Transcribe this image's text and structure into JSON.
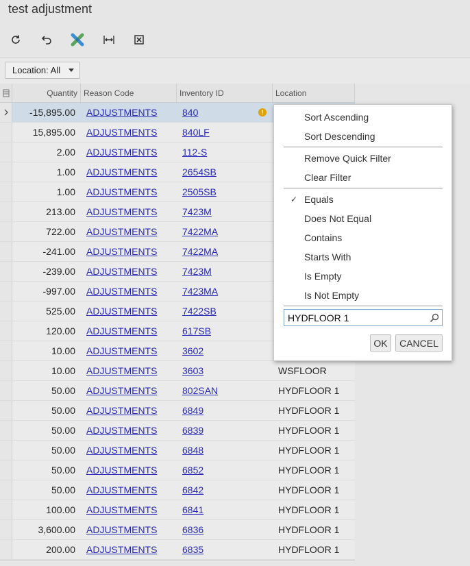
{
  "page": {
    "title": "test adjustment"
  },
  "toolbar": {
    "icons": [
      "refresh-icon",
      "undo-icon",
      "fit-columns-icon",
      "fit-width-icon",
      "export-excel-icon"
    ]
  },
  "filter": {
    "location_label": "Location: All"
  },
  "grid": {
    "columns": {
      "quantity": "Quantity",
      "reason": "Reason Code",
      "inventory": "Inventory ID",
      "location": "Location"
    },
    "rows": [
      {
        "qty": "-15,895.00",
        "reason": "ADJUSTMENTS",
        "inv": "840",
        "loc": ""
      },
      {
        "qty": "15,895.00",
        "reason": "ADJUSTMENTS",
        "inv": "840LF",
        "loc": ""
      },
      {
        "qty": "2.00",
        "reason": "ADJUSTMENTS",
        "inv": "112-S",
        "loc": ""
      },
      {
        "qty": "1.00",
        "reason": "ADJUSTMENTS",
        "inv": "2654SB",
        "loc": ""
      },
      {
        "qty": "1.00",
        "reason": "ADJUSTMENTS",
        "inv": "2505SB",
        "loc": ""
      },
      {
        "qty": "213.00",
        "reason": "ADJUSTMENTS",
        "inv": "7423M",
        "loc": ""
      },
      {
        "qty": "722.00",
        "reason": "ADJUSTMENTS",
        "inv": "7422MA",
        "loc": ""
      },
      {
        "qty": "-241.00",
        "reason": "ADJUSTMENTS",
        "inv": "7422MA",
        "loc": ""
      },
      {
        "qty": "-239.00",
        "reason": "ADJUSTMENTS",
        "inv": "7423M",
        "loc": ""
      },
      {
        "qty": "-997.00",
        "reason": "ADJUSTMENTS",
        "inv": "7423MA",
        "loc": ""
      },
      {
        "qty": "525.00",
        "reason": "ADJUSTMENTS",
        "inv": "7422SB",
        "loc": ""
      },
      {
        "qty": "120.00",
        "reason": "ADJUSTMENTS",
        "inv": "617SB",
        "loc": ""
      },
      {
        "qty": "10.00",
        "reason": "ADJUSTMENTS",
        "inv": "3602",
        "loc": ""
      },
      {
        "qty": "10.00",
        "reason": "ADJUSTMENTS",
        "inv": "3603",
        "loc": "WSFLOOR"
      },
      {
        "qty": "50.00",
        "reason": "ADJUSTMENTS",
        "inv": "802SAN",
        "loc": "HYDFLOOR 1"
      },
      {
        "qty": "50.00",
        "reason": "ADJUSTMENTS",
        "inv": "6849",
        "loc": "HYDFLOOR 1"
      },
      {
        "qty": "50.00",
        "reason": "ADJUSTMENTS",
        "inv": "6839",
        "loc": "HYDFLOOR 1"
      },
      {
        "qty": "50.00",
        "reason": "ADJUSTMENTS",
        "inv": "6848",
        "loc": "HYDFLOOR 1"
      },
      {
        "qty": "50.00",
        "reason": "ADJUSTMENTS",
        "inv": "6852",
        "loc": "HYDFLOOR 1"
      },
      {
        "qty": "50.00",
        "reason": "ADJUSTMENTS",
        "inv": "6842",
        "loc": "HYDFLOOR 1"
      },
      {
        "qty": "100.00",
        "reason": "ADJUSTMENTS",
        "inv": "6841",
        "loc": "HYDFLOOR 1"
      },
      {
        "qty": "3,600.00",
        "reason": "ADJUSTMENTS",
        "inv": "6836",
        "loc": "HYDFLOOR 1"
      },
      {
        "qty": "200.00",
        "reason": "ADJUSTMENTS",
        "inv": "6835",
        "loc": "HYDFLOOR 1"
      }
    ]
  },
  "popup": {
    "sort_asc": "Sort Ascending",
    "sort_desc": "Sort Descending",
    "remove_quick": "Remove Quick Filter",
    "clear": "Clear Filter",
    "check_mark": "✓",
    "equals": "Equals",
    "not_equal": "Does Not Equal",
    "contains": "Contains",
    "starts_with": "Starts With",
    "is_empty": "Is Empty",
    "is_not_empty": "Is Not Empty",
    "filter_value": "HYDFLOOR 1",
    "ok": "OK",
    "cancel": "CANCEL"
  },
  "colors": {
    "link": "#2a2ab8",
    "selected_row": "#cfdbe6",
    "warning": "#e0a400"
  }
}
